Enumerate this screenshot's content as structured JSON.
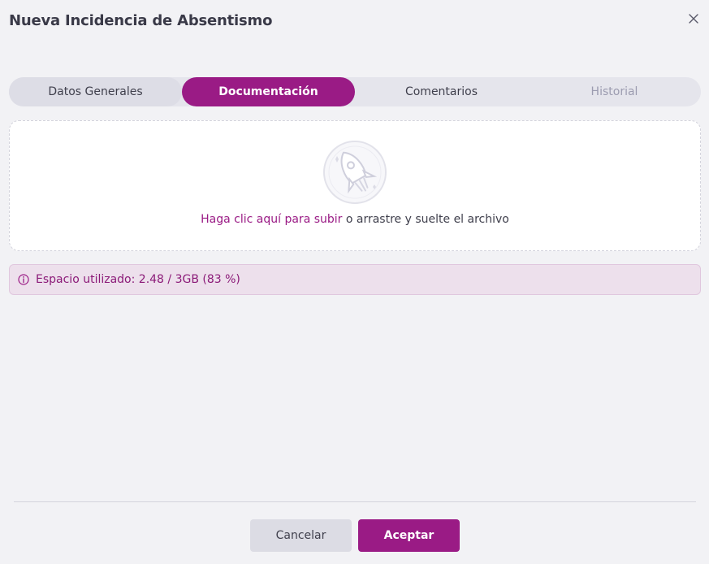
{
  "dialog": {
    "title": "Nueva Incidencia de Absentismo",
    "close_icon": "close-icon"
  },
  "tabs": [
    {
      "label": "Datos Generales",
      "state": "default"
    },
    {
      "label": "Documentación",
      "state": "active"
    },
    {
      "label": "Comentarios",
      "state": "default"
    },
    {
      "label": "Historial",
      "state": "disabled"
    }
  ],
  "upload": {
    "icon": "rocket-icon",
    "link_text": "Haga clic aquí para subir",
    "rest_text": " o arrastre y suelte el archivo"
  },
  "storage": {
    "icon": "info-icon",
    "text": "Espacio utilizado: 2.48 / 3GB (83 %)"
  },
  "footer": {
    "cancel_label": "Cancelar",
    "accept_label": "Aceptar"
  },
  "colors": {
    "accent": "#9a1b85",
    "background": "#f2f2f5",
    "notice_bg": "#ede0ec"
  }
}
